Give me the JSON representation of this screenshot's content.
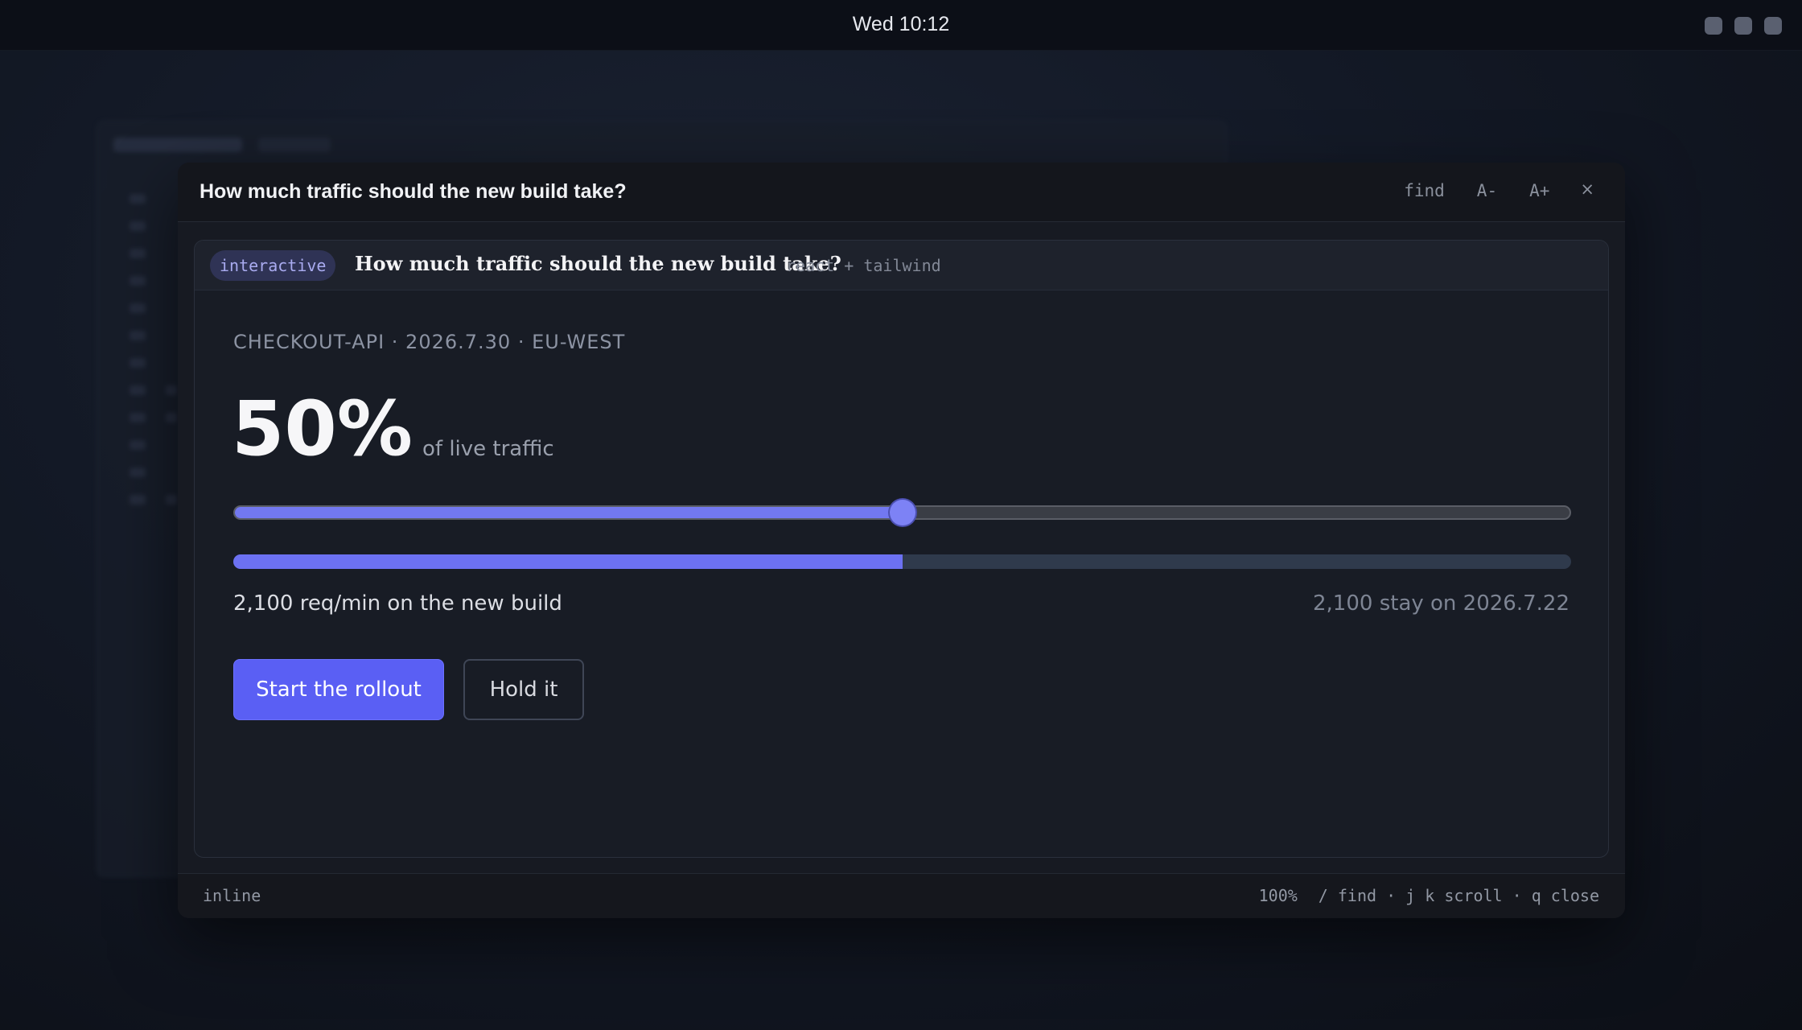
{
  "system": {
    "clock": "Wed 10:12"
  },
  "modal": {
    "title": "How much traffic should the new build take?",
    "actions": {
      "find": "find",
      "font_smaller": "A-",
      "font_larger": "A+",
      "close": "×"
    }
  },
  "card": {
    "badge": "interactive",
    "title": "How much traffic should the new build take?",
    "tech": "react + tailwind",
    "eyebrow": "CHECKOUT-API · 2026.7.30 · EU-WEST",
    "percent_label": "50%",
    "percent_caption": "of live traffic",
    "traffic_fraction": 0.5,
    "new_build_stat": "2,100 req/min on the new build",
    "old_build_stat": "2,100 stay on 2026.7.22",
    "primary_button": "Start the rollout",
    "secondary_button": "Hold it"
  },
  "footer": {
    "mode": "inline",
    "zoom": "100%",
    "shortcuts": "/ find · j k scroll · q close"
  },
  "colors": {
    "accent": "#5a5ff4",
    "slider_fill": "#7278f0",
    "background": "#171a22"
  }
}
